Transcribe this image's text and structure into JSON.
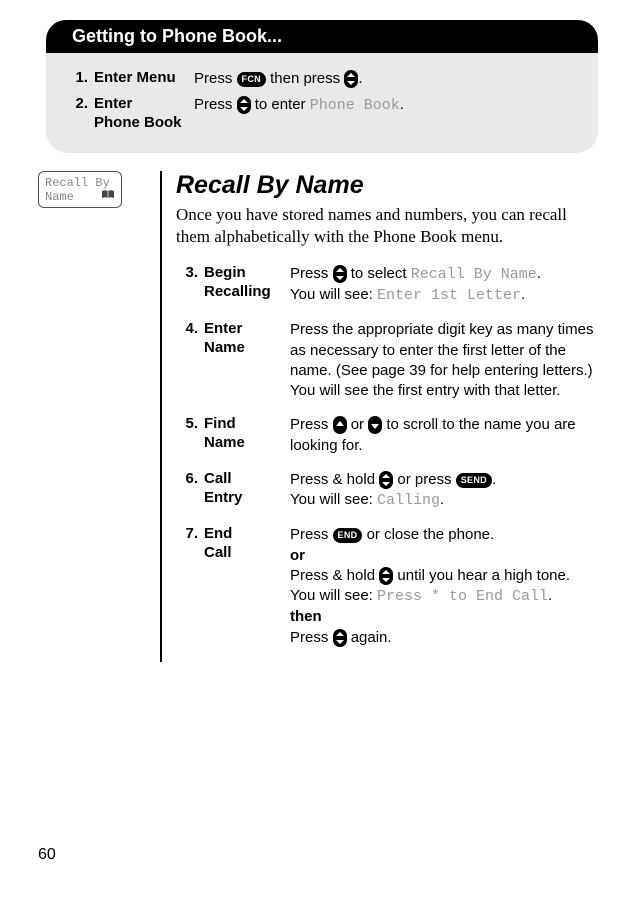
{
  "page_number": "60",
  "tab_title": "Getting to Phone Book...",
  "keys": {
    "fcn": "FCN",
    "send": "SEND",
    "end": "END"
  },
  "top_steps": {
    "s1": {
      "num": "1.",
      "label": "Enter Menu",
      "pre": "Press ",
      "mid": " then press ",
      "post": "."
    },
    "s2": {
      "num": "2.",
      "label1": "Enter",
      "label2": "Phone Book",
      "pre": "Press ",
      "mid": " to enter ",
      "lcd": "Phone Book",
      "post": "."
    }
  },
  "screen": {
    "line1": "Recall By",
    "line2": "Name",
    "icon": "open-book-icon"
  },
  "section": {
    "title": "Recall By Name",
    "intro": "Once you have stored names and numbers, you can recall them alphabetically with the Phone Book menu."
  },
  "steps": {
    "s3": {
      "num": "3.",
      "label1": "Begin",
      "label2": "Recalling",
      "a1": "Press ",
      "a2": " to select ",
      "lcd1": "Recall By Name",
      "a3": ".",
      "b1": "You will see: ",
      "lcd2": "Enter 1st Letter",
      "b2": "."
    },
    "s4": {
      "num": "4.",
      "label1": "Enter",
      "label2": "Name",
      "body": "Press the appropriate digit key as many times as necessary to enter the first letter of the name. (See page 39 for help entering letters.) You will see the first entry with that letter."
    },
    "s5": {
      "num": "5.",
      "label1": "Find",
      "label2": "Name",
      "a1": "Press ",
      "a2": " or ",
      "a3": " to scroll to the name you are looking for."
    },
    "s6": {
      "num": "6.",
      "label1": "Call",
      "label2": "Entry",
      "a1": "Press & hold ",
      "a2": " or press ",
      "a3": ".",
      "b1": "You will see: ",
      "lcd": "Calling",
      "b2": "."
    },
    "s7": {
      "num": "7.",
      "label1": "End",
      "label2": "Call",
      "a1": "Press ",
      "a2": " or close the phone.",
      "or": "or",
      "b1": "Press & hold ",
      "b2": " until you hear a high tone.",
      "c1": "You will see: ",
      "lcd": "Press * to End Call",
      "c2": ".",
      "then": "then",
      "d1": "Press ",
      "d2": " again."
    }
  }
}
